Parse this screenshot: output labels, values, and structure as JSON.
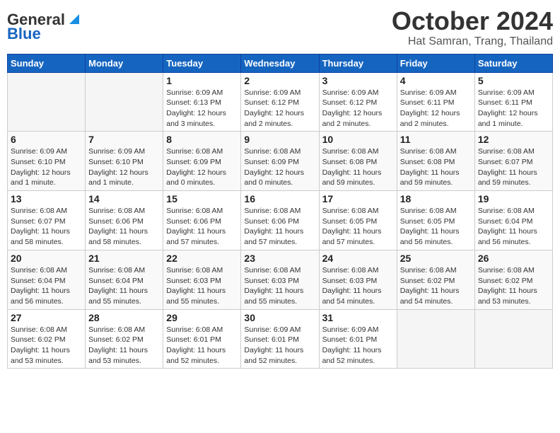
{
  "logo": {
    "line1": "General",
    "line2": "Blue"
  },
  "title": "October 2024",
  "subtitle": "Hat Samran, Trang, Thailand",
  "weekdays": [
    "Sunday",
    "Monday",
    "Tuesday",
    "Wednesday",
    "Thursday",
    "Friday",
    "Saturday"
  ],
  "weeks": [
    [
      {
        "day": "",
        "info": ""
      },
      {
        "day": "",
        "info": ""
      },
      {
        "day": "1",
        "info": "Sunrise: 6:09 AM\nSunset: 6:13 PM\nDaylight: 12 hours and 3 minutes."
      },
      {
        "day": "2",
        "info": "Sunrise: 6:09 AM\nSunset: 6:12 PM\nDaylight: 12 hours and 2 minutes."
      },
      {
        "day": "3",
        "info": "Sunrise: 6:09 AM\nSunset: 6:12 PM\nDaylight: 12 hours and 2 minutes."
      },
      {
        "day": "4",
        "info": "Sunrise: 6:09 AM\nSunset: 6:11 PM\nDaylight: 12 hours and 2 minutes."
      },
      {
        "day": "5",
        "info": "Sunrise: 6:09 AM\nSunset: 6:11 PM\nDaylight: 12 hours and 1 minute."
      }
    ],
    [
      {
        "day": "6",
        "info": "Sunrise: 6:09 AM\nSunset: 6:10 PM\nDaylight: 12 hours and 1 minute."
      },
      {
        "day": "7",
        "info": "Sunrise: 6:09 AM\nSunset: 6:10 PM\nDaylight: 12 hours and 1 minute."
      },
      {
        "day": "8",
        "info": "Sunrise: 6:08 AM\nSunset: 6:09 PM\nDaylight: 12 hours and 0 minutes."
      },
      {
        "day": "9",
        "info": "Sunrise: 6:08 AM\nSunset: 6:09 PM\nDaylight: 12 hours and 0 minutes."
      },
      {
        "day": "10",
        "info": "Sunrise: 6:08 AM\nSunset: 6:08 PM\nDaylight: 11 hours and 59 minutes."
      },
      {
        "day": "11",
        "info": "Sunrise: 6:08 AM\nSunset: 6:08 PM\nDaylight: 11 hours and 59 minutes."
      },
      {
        "day": "12",
        "info": "Sunrise: 6:08 AM\nSunset: 6:07 PM\nDaylight: 11 hours and 59 minutes."
      }
    ],
    [
      {
        "day": "13",
        "info": "Sunrise: 6:08 AM\nSunset: 6:07 PM\nDaylight: 11 hours and 58 minutes."
      },
      {
        "day": "14",
        "info": "Sunrise: 6:08 AM\nSunset: 6:06 PM\nDaylight: 11 hours and 58 minutes."
      },
      {
        "day": "15",
        "info": "Sunrise: 6:08 AM\nSunset: 6:06 PM\nDaylight: 11 hours and 57 minutes."
      },
      {
        "day": "16",
        "info": "Sunrise: 6:08 AM\nSunset: 6:06 PM\nDaylight: 11 hours and 57 minutes."
      },
      {
        "day": "17",
        "info": "Sunrise: 6:08 AM\nSunset: 6:05 PM\nDaylight: 11 hours and 57 minutes."
      },
      {
        "day": "18",
        "info": "Sunrise: 6:08 AM\nSunset: 6:05 PM\nDaylight: 11 hours and 56 minutes."
      },
      {
        "day": "19",
        "info": "Sunrise: 6:08 AM\nSunset: 6:04 PM\nDaylight: 11 hours and 56 minutes."
      }
    ],
    [
      {
        "day": "20",
        "info": "Sunrise: 6:08 AM\nSunset: 6:04 PM\nDaylight: 11 hours and 56 minutes."
      },
      {
        "day": "21",
        "info": "Sunrise: 6:08 AM\nSunset: 6:04 PM\nDaylight: 11 hours and 55 minutes."
      },
      {
        "day": "22",
        "info": "Sunrise: 6:08 AM\nSunset: 6:03 PM\nDaylight: 11 hours and 55 minutes."
      },
      {
        "day": "23",
        "info": "Sunrise: 6:08 AM\nSunset: 6:03 PM\nDaylight: 11 hours and 55 minutes."
      },
      {
        "day": "24",
        "info": "Sunrise: 6:08 AM\nSunset: 6:03 PM\nDaylight: 11 hours and 54 minutes."
      },
      {
        "day": "25",
        "info": "Sunrise: 6:08 AM\nSunset: 6:02 PM\nDaylight: 11 hours and 54 minutes."
      },
      {
        "day": "26",
        "info": "Sunrise: 6:08 AM\nSunset: 6:02 PM\nDaylight: 11 hours and 53 minutes."
      }
    ],
    [
      {
        "day": "27",
        "info": "Sunrise: 6:08 AM\nSunset: 6:02 PM\nDaylight: 11 hours and 53 minutes."
      },
      {
        "day": "28",
        "info": "Sunrise: 6:08 AM\nSunset: 6:02 PM\nDaylight: 11 hours and 53 minutes."
      },
      {
        "day": "29",
        "info": "Sunrise: 6:08 AM\nSunset: 6:01 PM\nDaylight: 11 hours and 52 minutes."
      },
      {
        "day": "30",
        "info": "Sunrise: 6:09 AM\nSunset: 6:01 PM\nDaylight: 11 hours and 52 minutes."
      },
      {
        "day": "31",
        "info": "Sunrise: 6:09 AM\nSunset: 6:01 PM\nDaylight: 11 hours and 52 minutes."
      },
      {
        "day": "",
        "info": ""
      },
      {
        "day": "",
        "info": ""
      }
    ]
  ]
}
